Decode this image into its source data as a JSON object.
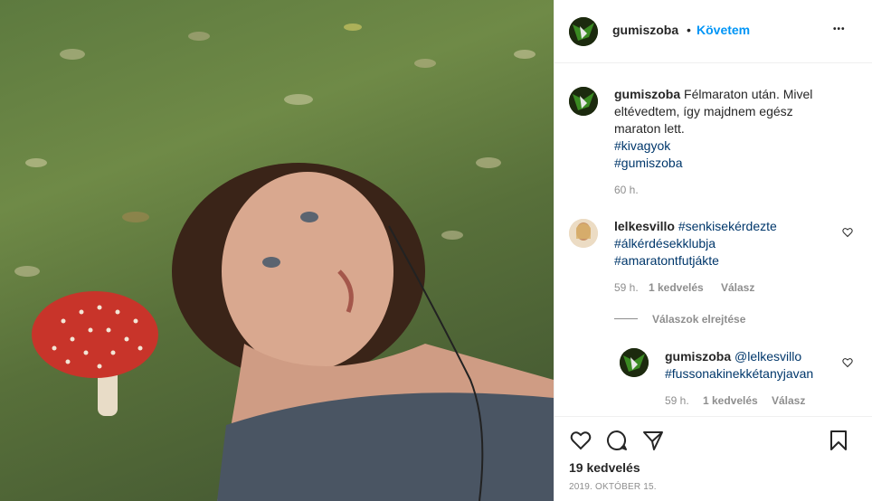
{
  "post": {
    "author": "gumiszoba",
    "follow_sep": "•",
    "follow_label": "Követem",
    "more_label": "•••"
  },
  "caption": {
    "author": "gumiszoba",
    "text_l1": "Félmaraton után. Mivel",
    "text_l2": "eltévedtem, így majdnem egész",
    "text_l3": "maraton lett.",
    "tag1": "#kivagyok",
    "tag2": "#gumiszoba",
    "time": "60 h."
  },
  "comments": [
    {
      "author": "lelkesvillo",
      "l1": "#senkisekérdezte",
      "l2": "#álkérdésekklubja",
      "l3": "#amaratontfutjákte",
      "time": "59 h.",
      "likes": "1 kedvelés",
      "reply": "Válasz"
    }
  ],
  "hide_replies": "Válaszok elrejtése",
  "reply": {
    "author": "gumiszoba",
    "mention": "@lelkesvillo",
    "tag": "#fussonakinekkétanyjavan",
    "time": "59 h.",
    "likes": "1 kedvelés",
    "reply": "Válasz"
  },
  "footer": {
    "likes": "19 kedvelés",
    "date": "2019. OKTÓBER 15."
  },
  "icons": [
    "heart-icon",
    "comment-icon",
    "share-icon",
    "bookmark-icon",
    "more-icon"
  ]
}
